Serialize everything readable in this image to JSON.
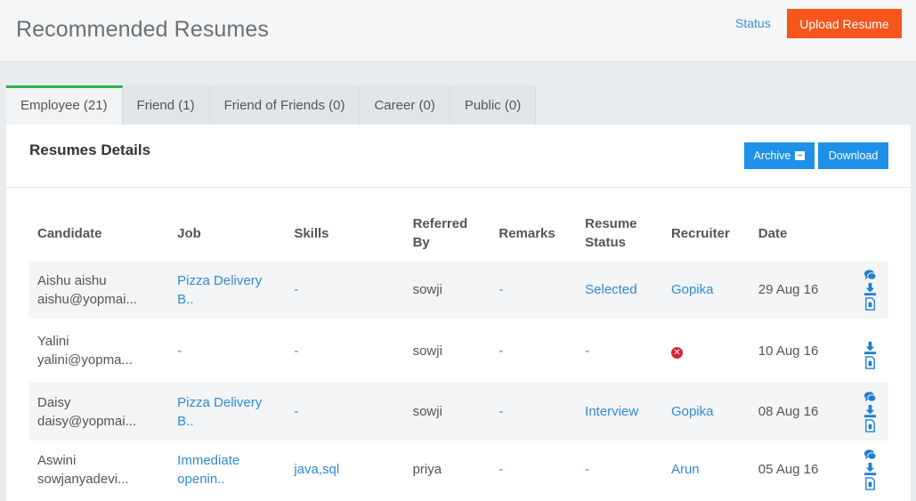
{
  "header": {
    "title": "Recommended Resumes",
    "status_link": "Status",
    "upload_button": "Upload Resume"
  },
  "tabs": [
    {
      "label": "Employee (21)",
      "active": true
    },
    {
      "label": "Friend (1)",
      "active": false
    },
    {
      "label": "Friend of Friends (0)",
      "active": false
    },
    {
      "label": "Career (0)",
      "active": false
    },
    {
      "label": "Public (0)",
      "active": false
    }
  ],
  "panel": {
    "title": "Resumes Details",
    "archive_button": "Archive",
    "download_button": "Download"
  },
  "table": {
    "headers": {
      "candidate": "Candidate",
      "job": "Job",
      "skills": "Skills",
      "referred_by": "Referred By",
      "remarks": "Remarks",
      "resume_status": "Resume Status",
      "recruiter": "Recruiter",
      "date": "Date"
    },
    "rows": [
      {
        "name": "Aishu aishu",
        "email": "aishu@yopmai...",
        "job": "Pizza Delivery B..",
        "skills": "-",
        "referred_by": "sowji",
        "remarks": "-",
        "status": "Selected",
        "recruiter": "Gopika",
        "date": "29 Aug 16"
      },
      {
        "name": "Yalini",
        "email": "yalini@yopma...",
        "job": "-",
        "skills": "-",
        "referred_by": "sowji",
        "remarks": "-",
        "status": "-",
        "recruiter": "",
        "date": "10 Aug 16"
      },
      {
        "name": "Daisy",
        "email": "daisy@yopmai...",
        "job": "Pizza Delivery B..",
        "skills": "-",
        "referred_by": "sowji",
        "remarks": "-",
        "status": "Interview",
        "recruiter": "Gopika",
        "date": "08 Aug 16"
      },
      {
        "name": "Aswini",
        "email": "sowjanyadevi...",
        "job": "Immediate openin..",
        "skills": "java,sql",
        "referred_by": "priya",
        "remarks": "-",
        "status": "-",
        "recruiter": "Arun",
        "date": "05 Aug 16"
      }
    ]
  },
  "icons": {
    "comment": "comment-icon",
    "download": "download-icon",
    "file": "file-icon",
    "remove": "remove-icon",
    "archive": "archive-box-icon"
  },
  "colors": {
    "accent": "#f6551b",
    "primary": "#1e90e8",
    "link": "#2f8ad6",
    "active_tab": "#2bb24c",
    "danger": "#d9223c"
  }
}
